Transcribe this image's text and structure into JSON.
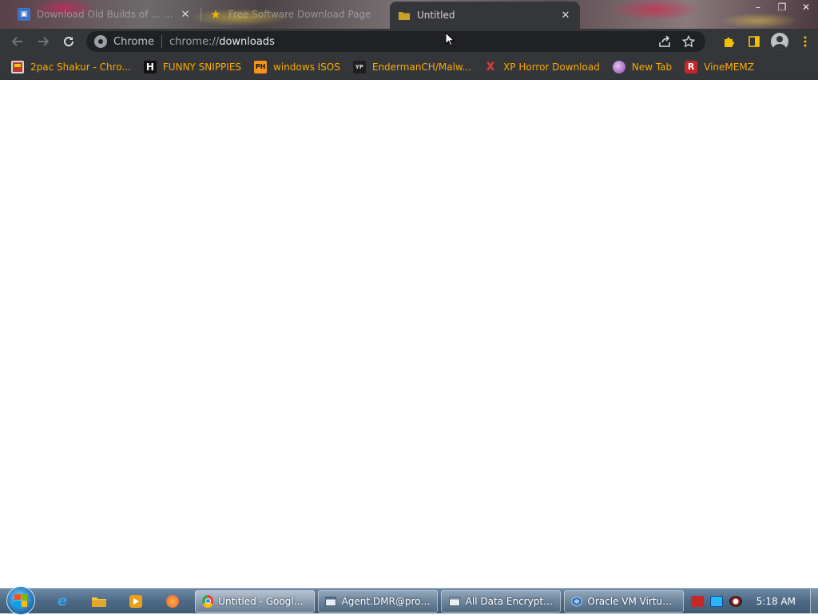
{
  "browser": {
    "tabs": [
      {
        "label": "Download Old Builds of ... - Oracle",
        "icon": "oracle-icon",
        "active": false
      },
      {
        "label": "Free Software Download Page",
        "icon": "star-icon",
        "active": false
      },
      {
        "label": "Untitled",
        "icon": "folder-icon",
        "active": true
      }
    ],
    "window_controls": {
      "minimize": "–",
      "restore": "❐",
      "close": "✕"
    }
  },
  "toolbar": {
    "chip": "Chrome",
    "url_scheme": "chrome://",
    "url_host": "downloads"
  },
  "bookmarks": [
    {
      "label": "2pac Shakur - Chro...",
      "icon": "image-icon",
      "icon_text": "",
      "icon_color": "#c0392b"
    },
    {
      "label": "FUNNY SNIPPIES",
      "icon": "h-icon",
      "icon_text": "H",
      "icon_color": "#ffffff"
    },
    {
      "label": "windows ISOS",
      "icon": "ph-icon",
      "icon_text": "PH",
      "icon_color": "#f7931e"
    },
    {
      "label": "EndermanCH/Malw...",
      "icon": "yp-icon",
      "icon_text": "YP",
      "icon_color": "#2b2b2b"
    },
    {
      "label": "XP Horror Download",
      "icon": "x-icon",
      "icon_text": "X",
      "icon_color": "#e53935"
    },
    {
      "label": "New Tab",
      "icon": "globe-icon",
      "icon_text": "",
      "icon_color": "#9b59b6"
    },
    {
      "label": "VineMEMZ",
      "icon": "r-icon",
      "icon_text": "R",
      "icon_color": "#c62828"
    }
  ],
  "taskbar": {
    "tasks": [
      {
        "label": "Untitled - Google C...",
        "icon": "chrome-icon",
        "active": true
      },
      {
        "label": "Agent.DMR@proto...",
        "icon": "window-icon",
        "active": false
      },
      {
        "label": "All Data Encrypted",
        "icon": "window-icon",
        "active": false
      },
      {
        "label": "Oracle VM VirtualB...",
        "icon": "virtualbox-icon",
        "active": false
      }
    ],
    "clock": "5:18 AM"
  },
  "colors": {
    "bookmark_text": "#f9ab00",
    "toolbar_bg": "#35363a",
    "omnibox_bg": "#202124"
  }
}
